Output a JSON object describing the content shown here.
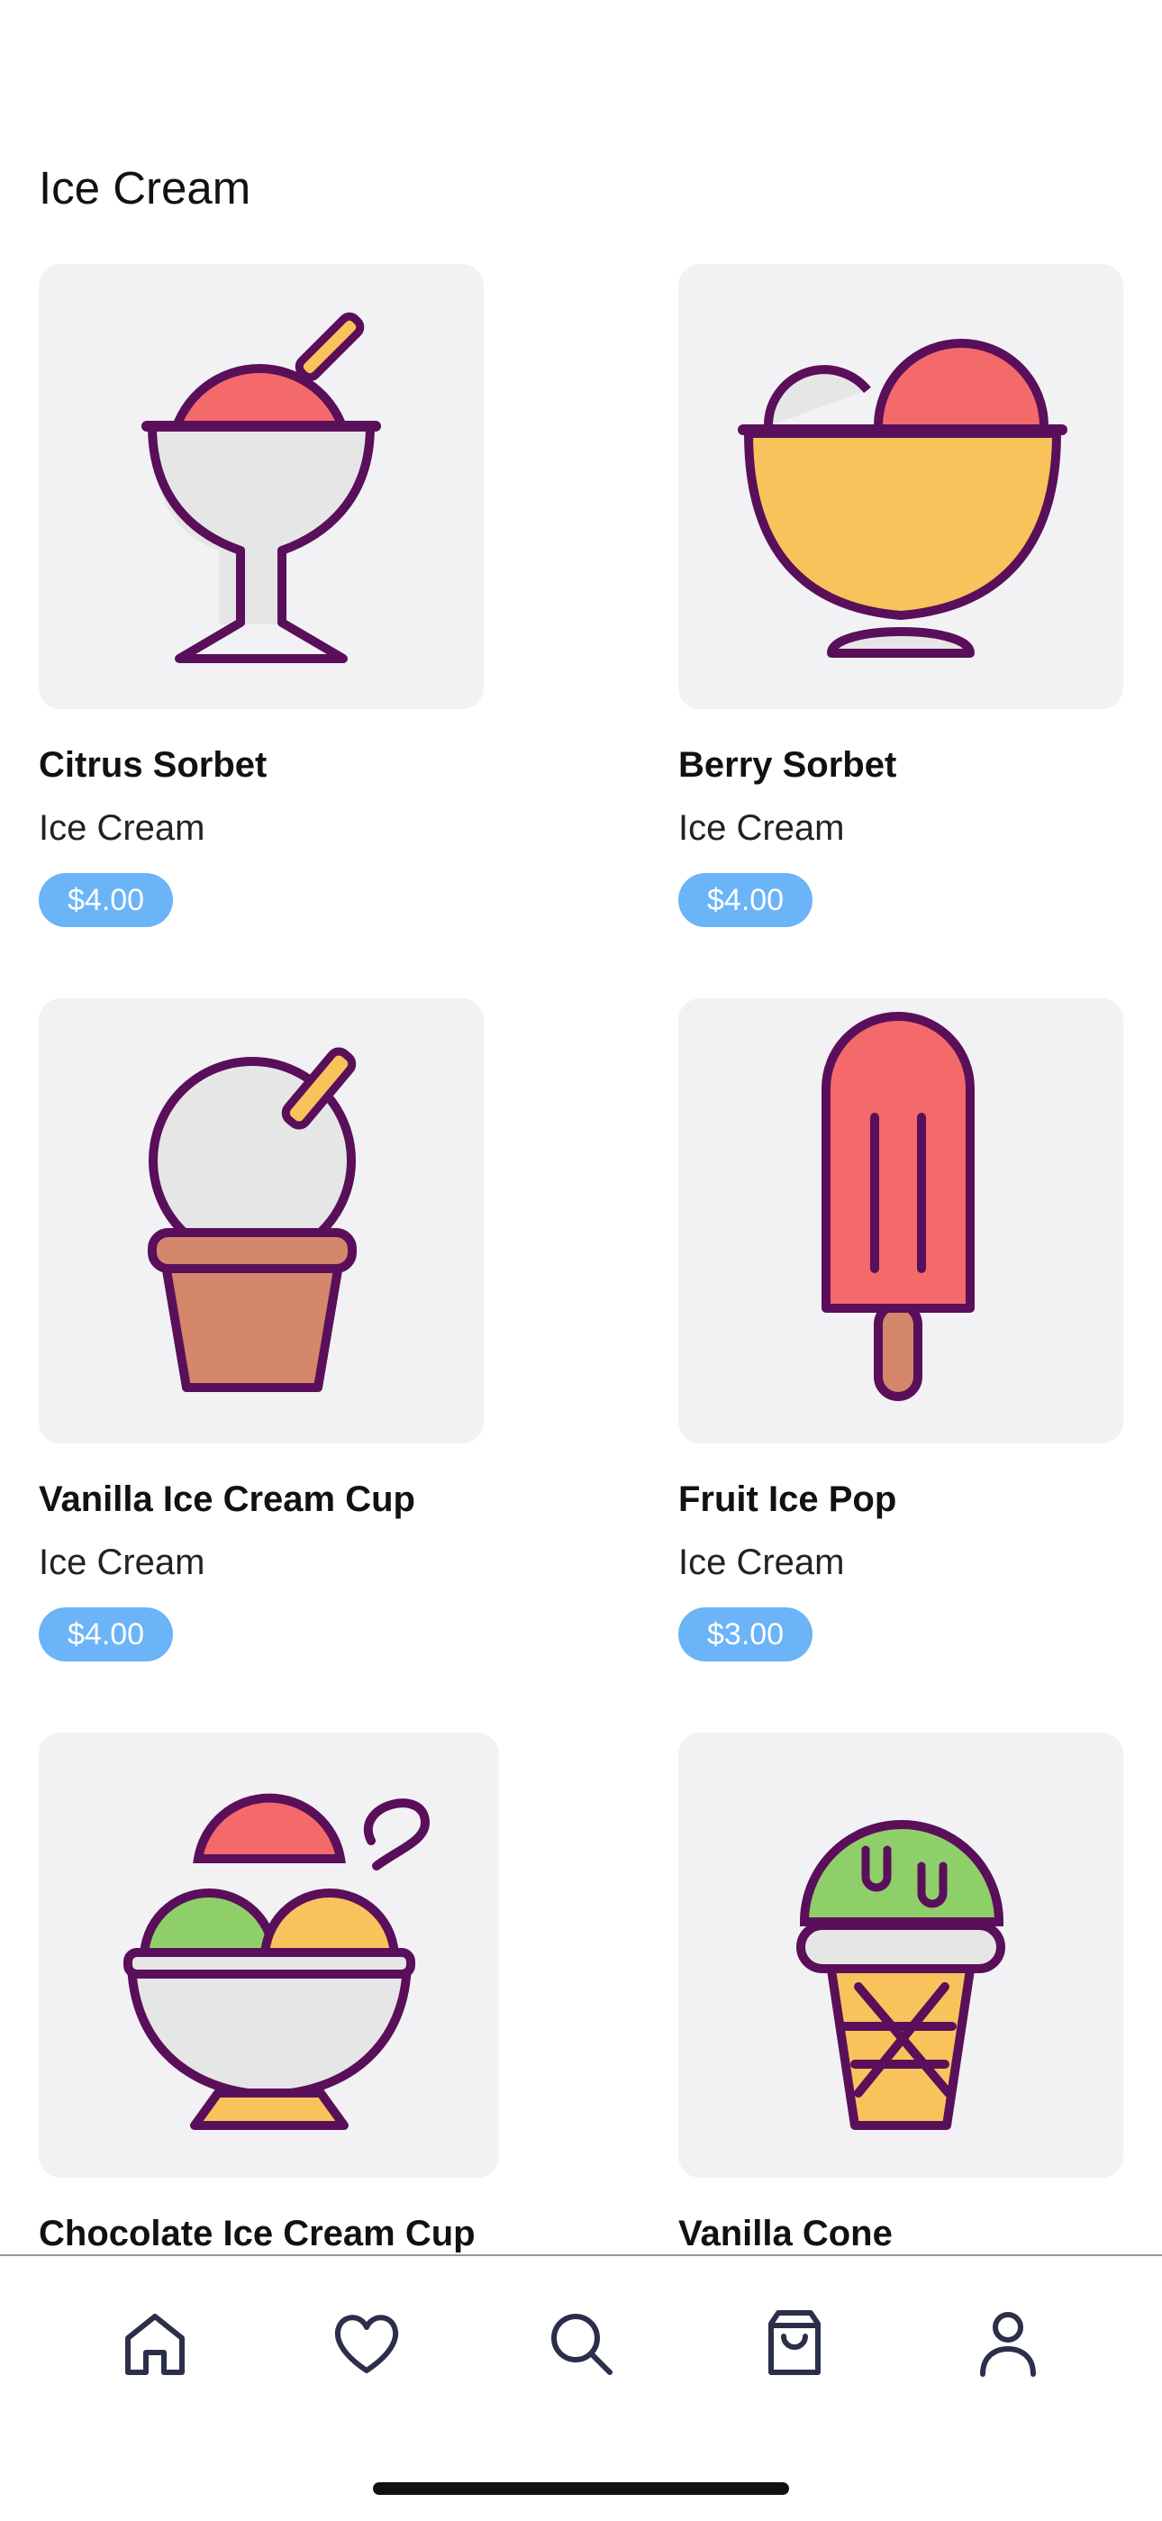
{
  "header": {
    "title": "Ice Cream"
  },
  "products": [
    {
      "name": "Citrus Sorbet",
      "category": "Ice Cream",
      "price": "$4.00",
      "icon": "sorbet-glass-icon"
    },
    {
      "name": "Berry Sorbet",
      "category": "Ice Cream",
      "price": "$4.00",
      "icon": "sorbet-bowl-icon"
    },
    {
      "name": "Vanilla Ice Cream Cup",
      "category": "Ice Cream",
      "price": "$4.00",
      "icon": "ice-cream-cup-icon"
    },
    {
      "name": "Fruit Ice Pop",
      "category": "Ice Cream",
      "price": "$3.00",
      "icon": "ice-pop-icon"
    },
    {
      "name": "Chocolate Ice Cream Cup",
      "icon": "ice-cream-bowl-icon"
    },
    {
      "name": "Vanilla Cone",
      "icon": "ice-cream-cone-icon"
    }
  ],
  "tabbar": {
    "items": [
      {
        "icon": "home-icon"
      },
      {
        "icon": "heart-icon"
      },
      {
        "icon": "search-icon"
      },
      {
        "icon": "shopping-bag-icon"
      },
      {
        "icon": "profile-icon"
      }
    ]
  },
  "colors": {
    "accent": "#6ab4f7",
    "card_background": "#f2f2f4",
    "outline": "#5a0f5a"
  }
}
